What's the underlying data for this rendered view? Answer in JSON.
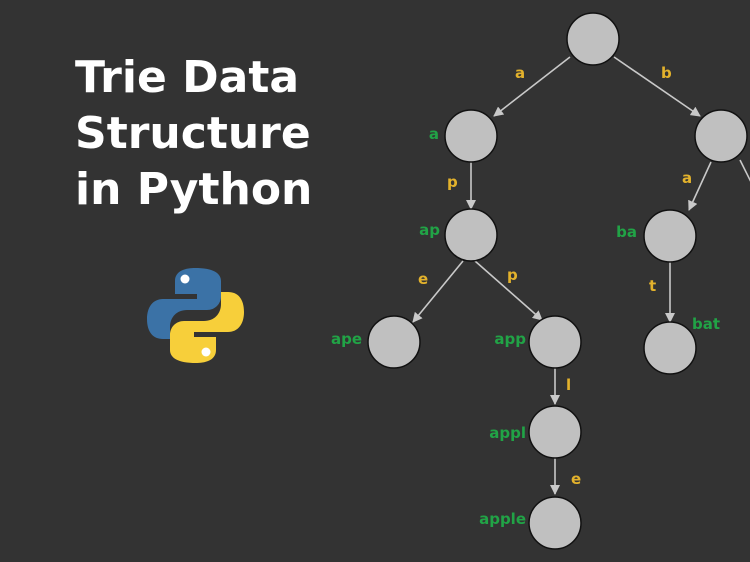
{
  "title_lines": [
    "Trie Data",
    "Structure",
    "in Python"
  ],
  "logo_icon": "python-logo-icon",
  "colors": {
    "background": "#333333",
    "title": "#ffffff",
    "node_fill": "#c0c0c0",
    "node_stroke": "#111111",
    "edge": "#c9c9c9",
    "edge_label": "#e3b22c",
    "node_label": "#21a346",
    "python_blue": "#3b72a6",
    "python_yellow": "#f7cf3a"
  },
  "trie": {
    "nodes": [
      {
        "id": "root",
        "label": ""
      },
      {
        "id": "a",
        "label": "a"
      },
      {
        "id": "b",
        "label": ""
      },
      {
        "id": "ap",
        "label": "ap"
      },
      {
        "id": "ba",
        "label": "ba"
      },
      {
        "id": "b2",
        "label": ""
      },
      {
        "id": "ape",
        "label": "ape"
      },
      {
        "id": "app",
        "label": "app"
      },
      {
        "id": "bat",
        "label": "bat"
      },
      {
        "id": "appl",
        "label": "appl"
      },
      {
        "id": "apple",
        "label": "apple"
      }
    ],
    "edges": [
      {
        "id": "root-a",
        "from": "root",
        "to": "a",
        "char": "a"
      },
      {
        "id": "root-b",
        "from": "root",
        "to": "b",
        "char": "b"
      },
      {
        "id": "a-ap",
        "from": "a",
        "to": "ap",
        "char": "p"
      },
      {
        "id": "b-ba",
        "from": "b",
        "to": "ba",
        "char": "a"
      },
      {
        "id": "b-b2",
        "from": "b",
        "to": "b2",
        "char": ""
      },
      {
        "id": "ap-ape",
        "from": "ap",
        "to": "ape",
        "char": "e"
      },
      {
        "id": "ap-app",
        "from": "ap",
        "to": "app",
        "char": "p"
      },
      {
        "id": "ba-bat",
        "from": "ba",
        "to": "bat",
        "char": "t"
      },
      {
        "id": "app-appl",
        "from": "app",
        "to": "appl",
        "char": "l"
      },
      {
        "id": "appl-apple",
        "from": "appl",
        "to": "apple",
        "char": "e"
      }
    ]
  }
}
